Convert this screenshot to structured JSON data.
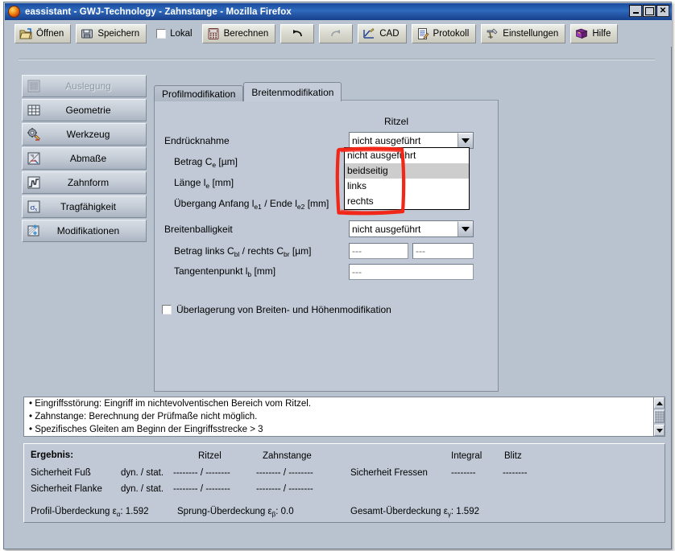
{
  "window": {
    "title": "eassistant - GWJ-Technology - Zahnstange - Mozilla Firefox",
    "minimize_label": "_",
    "maximize_label": "",
    "close_label": "✕"
  },
  "toolbar": {
    "open_label": "Öffnen",
    "save_label": "Speichern",
    "lokal_label": "Lokal",
    "calc_label": "Berechnen",
    "undo_label": "",
    "redo_label": "",
    "cad_label": "CAD",
    "protocol_label": "Protokoll",
    "settings_label": "Einstellungen",
    "help_label": "Hilfe"
  },
  "sidebar": {
    "items": [
      {
        "label": "Auslegung",
        "icon": "calculator-icon",
        "disabled": true
      },
      {
        "label": "Geometrie",
        "icon": "grid-icon",
        "disabled": false
      },
      {
        "label": "Werkzeug",
        "icon": "gear-tool-icon",
        "disabled": false
      },
      {
        "label": "Abmaße",
        "icon": "dimension-icon",
        "disabled": false
      },
      {
        "label": "Zahnform",
        "icon": "tooth-profile-icon",
        "disabled": false
      },
      {
        "label": "Tragfähigkeit",
        "icon": "sigma-x-icon",
        "disabled": false
      },
      {
        "label": "Modifikationen",
        "icon": "modification-icon",
        "disabled": false
      }
    ]
  },
  "tabs": [
    {
      "label": "Profilmodifikation",
      "active": false
    },
    {
      "label": "Breitenmodifikation",
      "active": true
    }
  ],
  "form": {
    "column_header": "Ritzel",
    "endruecknahme_label": "Endrücknahme",
    "endruecknahme_value": "nicht ausgeführt",
    "betrag_ce_label": "Betrag C",
    "betrag_ce_sub": "e",
    "betrag_ce_unit": " [µm]",
    "laenge_le_label": "Länge l",
    "laenge_le_sub": "e",
    "laenge_le_unit": " [mm]",
    "uebergang_label": "Übergang Anfang l",
    "uebergang_sub1": "e1",
    "uebergang_mid": " / Ende l",
    "uebergang_sub2": "e2",
    "uebergang_unit": " [mm]",
    "breitenballigkeit_label": "Breitenballigkeit",
    "breitenballigkeit_value": "nicht ausgeführt",
    "betrag_cb_label": "Betrag links C",
    "betrag_cb_sub1": "bl",
    "betrag_cb_mid": " / rechts C",
    "betrag_cb_sub2": "br",
    "betrag_cb_unit": " [µm]",
    "betrag_cb_left_value": "---",
    "betrag_cb_right_value": "---",
    "tangentenpunkt_label": "Tangentenpunkt l",
    "tangentenpunkt_sub": "b",
    "tangentenpunkt_unit": " [mm]",
    "tangentenpunkt_value": "---",
    "ueberlagerung_label": "Überlagerung von Breiten- und Höhenmodifikation",
    "ueberlagerung_checked": false
  },
  "dropdown": {
    "open": true,
    "options": [
      {
        "label": "nicht ausgeführt",
        "selected": false
      },
      {
        "label": "beidseitig",
        "selected": true
      },
      {
        "label": "links",
        "selected": false
      },
      {
        "label": "rechts",
        "selected": false
      }
    ]
  },
  "annotation": {
    "color": "#f22718",
    "shape": "rectangle"
  },
  "messages": {
    "lines": [
      "• Eingriffsstörung: Eingriff im nichtevolventischen Bereich vom Ritzel.",
      "• Zahnstange: Berechnung der Prüfmaße nicht möglich.",
      "• Spezifisches Gleiten am Beginn der Eingriffsstrecke > 3"
    ]
  },
  "result": {
    "title": "Ergebnis:",
    "col_ritzel": "Ritzel",
    "col_zahnstange": "Zahnstange",
    "col_integral": "Integral",
    "col_blitz": "Blitz",
    "row_fuss_label": "Sicherheit Fuß",
    "row_fuss_dynstat": "dyn. / stat.",
    "row_fuss_ritzel": "-------- / --------",
    "row_fuss_zahnstange": "-------- / --------",
    "row_flanke_label": "Sicherheit Flanke",
    "row_flanke_dynstat": "dyn. / stat.",
    "row_flanke_ritzel": "-------- / --------",
    "row_flanke_zahnstange": "-------- / --------",
    "fressen_label": "Sicherheit Fressen",
    "fressen_integral": "--------",
    "fressen_blitz": "--------",
    "profil_label": "Profil-Überdeckung ε",
    "profil_sub": "α",
    "profil_value": ": 1.592",
    "sprung_label": "Sprung-Überdeckung ε",
    "sprung_sub": "β",
    "sprung_value": ": 0.0",
    "gesamt_label": "Gesamt-Überdeckung ε",
    "gesamt_sub": "γ",
    "gesamt_value": ": 1.592"
  }
}
